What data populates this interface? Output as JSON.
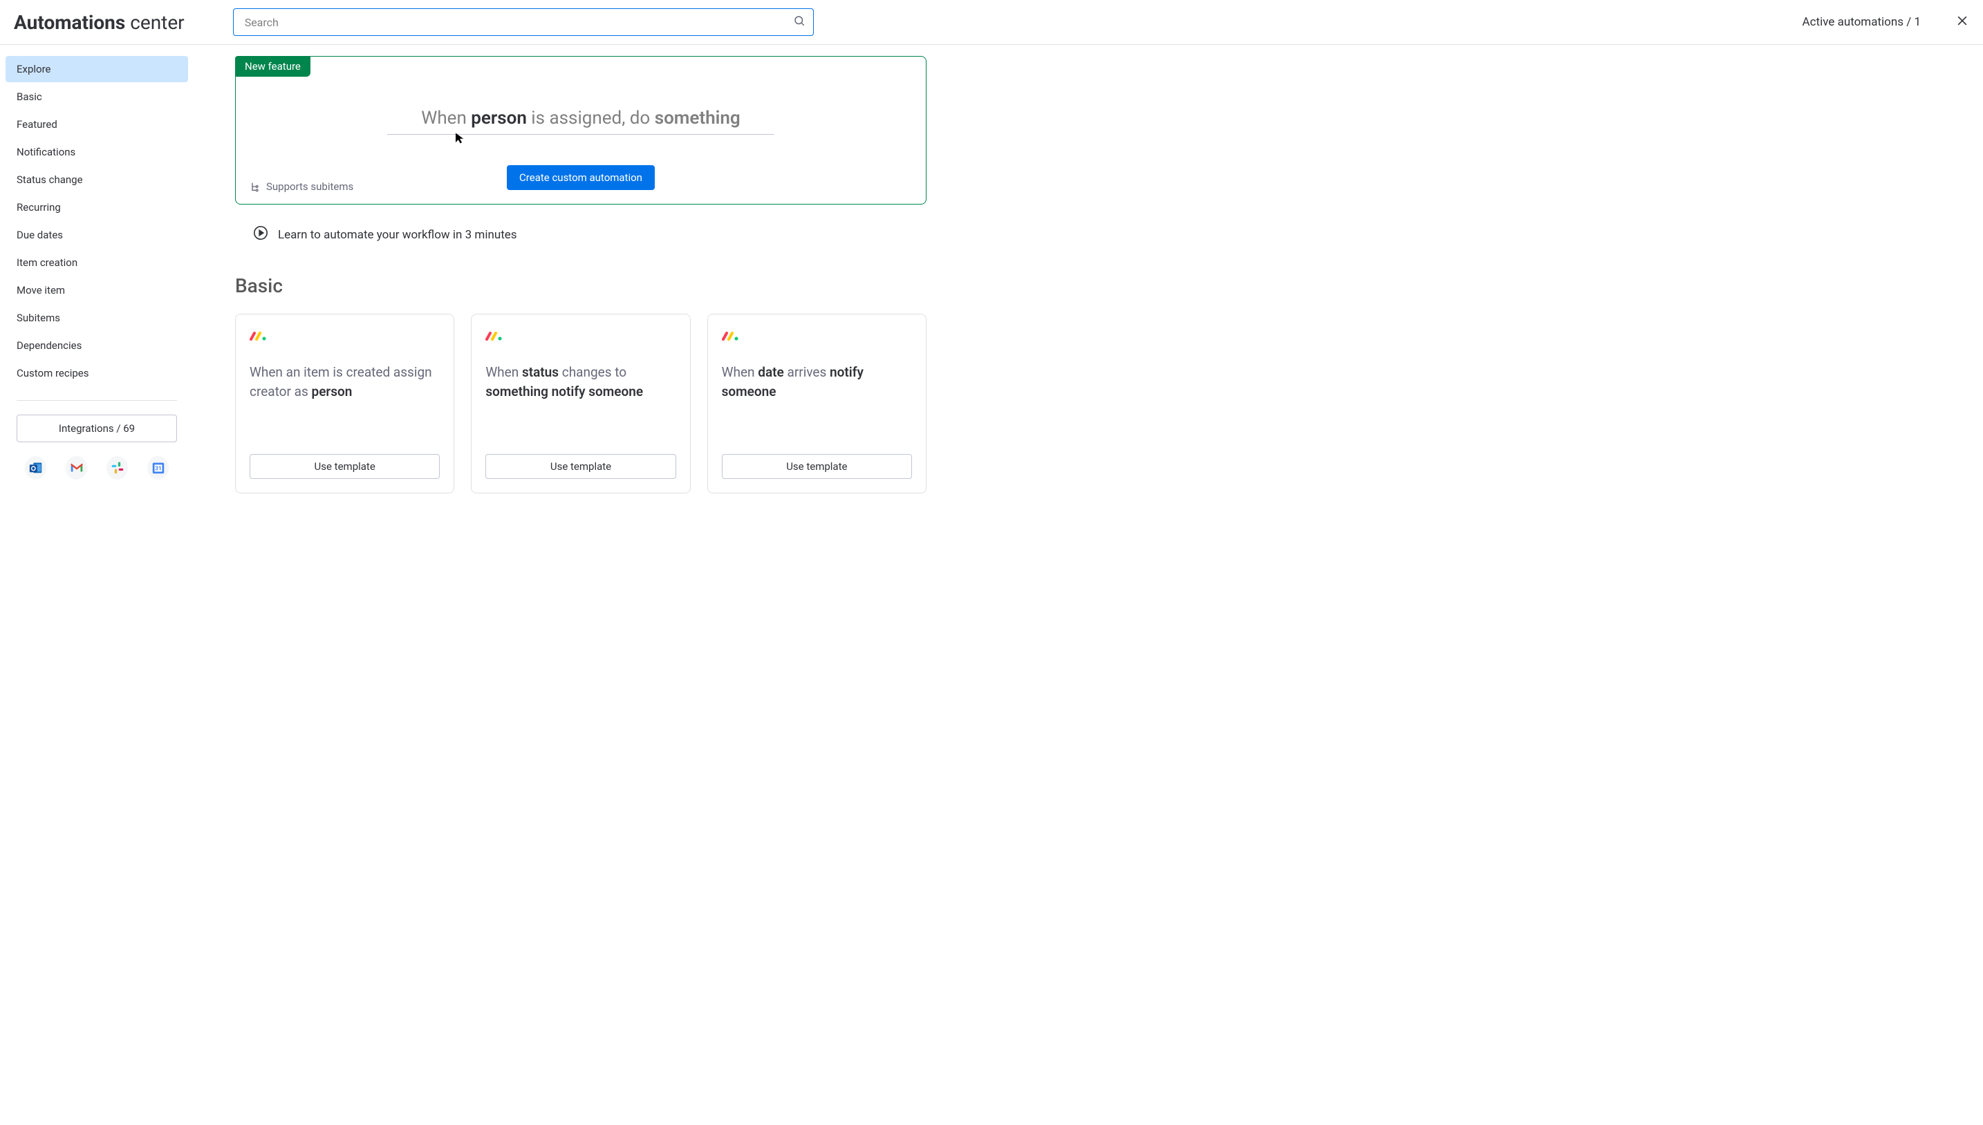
{
  "header": {
    "title_bold": "Automations",
    "title_rest": " center",
    "search_placeholder": "Search",
    "active_automations_label": "Active automations / 1"
  },
  "sidebar": {
    "items": [
      {
        "label": "Explore",
        "active": true
      },
      {
        "label": "Basic"
      },
      {
        "label": "Featured"
      },
      {
        "label": "Notifications"
      },
      {
        "label": "Status change"
      },
      {
        "label": "Recurring"
      },
      {
        "label": "Due dates"
      },
      {
        "label": "Item creation"
      },
      {
        "label": "Move item"
      },
      {
        "label": "Subitems"
      },
      {
        "label": "Dependencies"
      },
      {
        "label": "Custom recipes"
      }
    ],
    "integrations_label": "Integrations / 69"
  },
  "featured": {
    "badge": "New feature",
    "formula_when": "When ",
    "formula_person": "person",
    "formula_assigned": " is assigned, ",
    "formula_do": "do ",
    "formula_something": "something",
    "create_button": "Create custom automation",
    "supports": "Supports subitems"
  },
  "learn": {
    "text": "Learn to automate your workflow in 3 minutes"
  },
  "basic_section": {
    "title": "Basic",
    "use_template": "Use template",
    "cards": [
      {
        "p1": "When an item is created assign creator as ",
        "e1": "person",
        "p2": "",
        "e2": "",
        "p3": ""
      },
      {
        "p1": "When ",
        "e1": "status",
        "p2": " changes to ",
        "e2": "something notify someone",
        "p3": ""
      },
      {
        "p1": "When ",
        "e1": "date",
        "p2": " arrives ",
        "e2": "notify someone",
        "p3": ""
      }
    ]
  }
}
